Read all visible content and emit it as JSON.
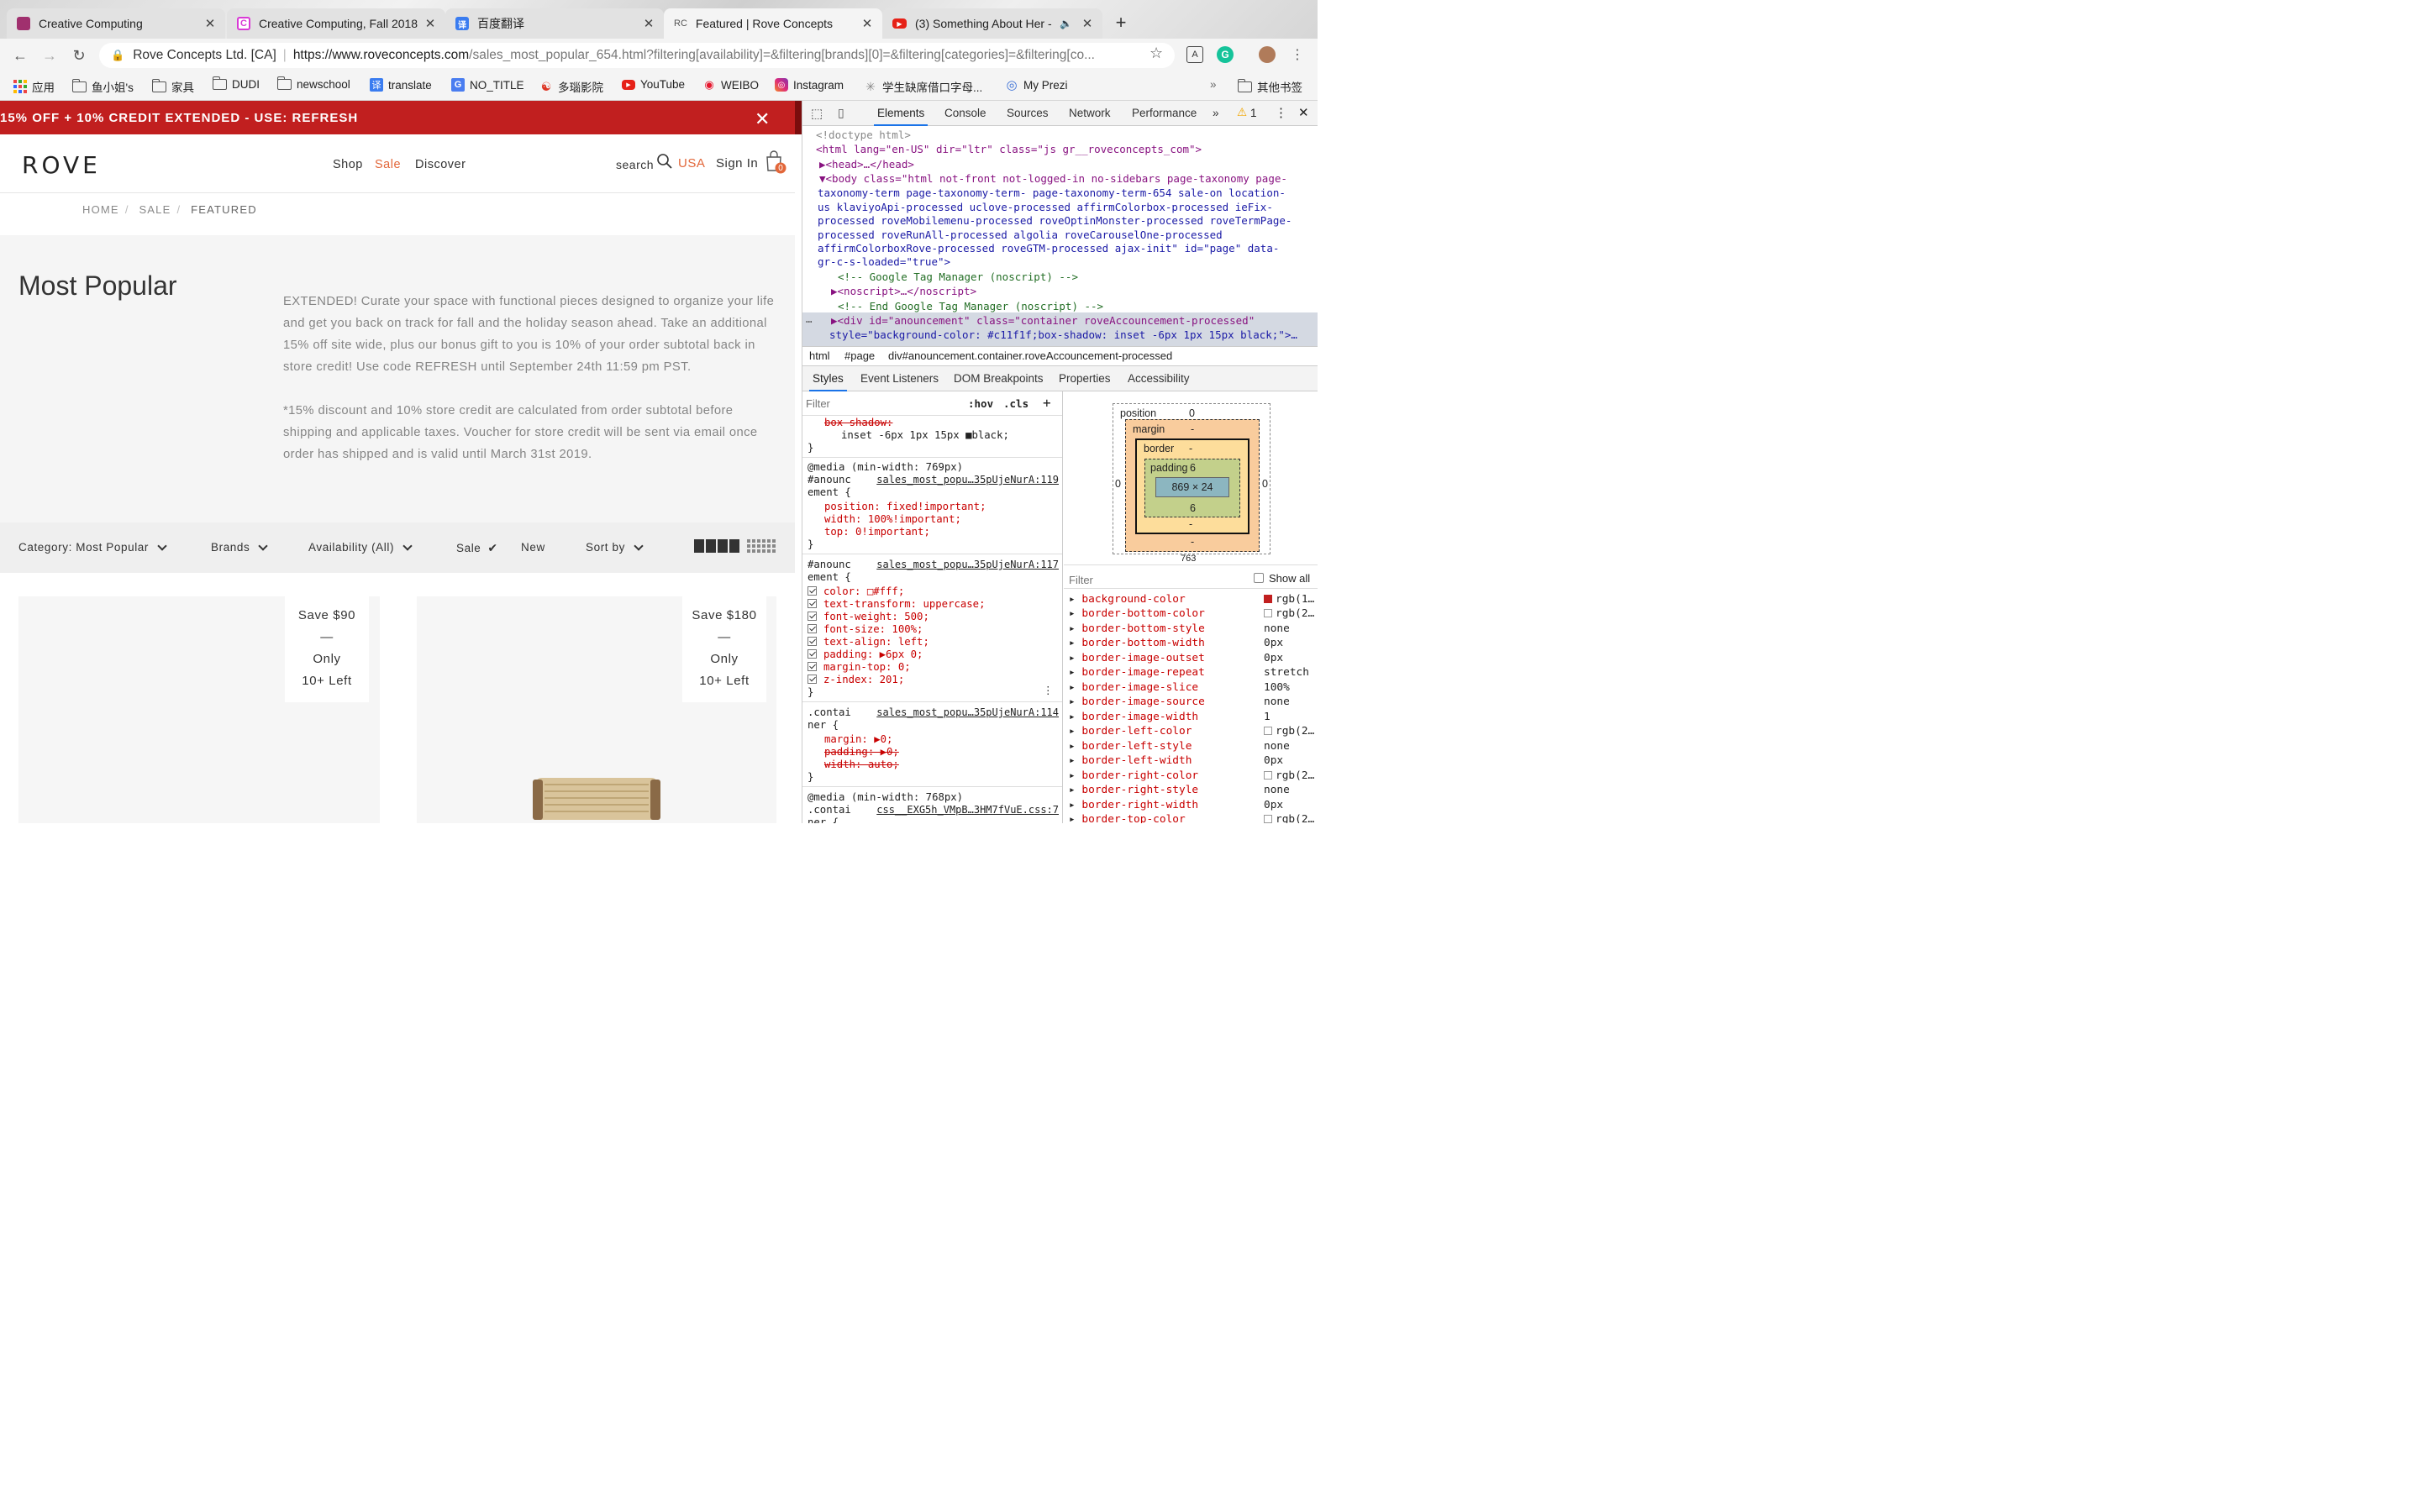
{
  "browser": {
    "tabs": [
      {
        "title": "Creative Computing",
        "fav_color": "#a0306e",
        "fav_glyph": ""
      },
      {
        "title": "Creative Computing, Fall 2018",
        "fav_color": "#d93ad6",
        "fav_glyph": "C"
      },
      {
        "title": "百度翻译",
        "fav_color": "#3a7cf0",
        "fav_glyph": "译"
      },
      {
        "title": "Featured | Rove Concepts",
        "fav_color": "#f4f4f4",
        "fav_glyph": "RC"
      },
      {
        "title": "(3) Something About Her -",
        "fav_color": "#e62117",
        "fav_glyph": "▶"
      }
    ],
    "url": {
      "org": "Rove Concepts Ltd. [CA]",
      "scheme_host": "https://www.roveconcepts.com",
      "path": "/sales_most_popular_654.html?filtering[availability]=&filtering[brands][0]=&filtering[categories]=&filtering[co..."
    },
    "bookmarks": [
      {
        "label": "应用",
        "type": "apps"
      },
      {
        "label": "鱼小姐's",
        "type": "folder"
      },
      {
        "label": "家具",
        "type": "folder"
      },
      {
        "label": "DUDI",
        "type": "folder"
      },
      {
        "label": "newschool",
        "type": "folder"
      },
      {
        "label": "translate",
        "type": "translate"
      },
      {
        "label": "NO_TITLE",
        "type": "google"
      },
      {
        "label": "多瑙影院",
        "type": "swirl"
      },
      {
        "label": "YouTube",
        "type": "youtube"
      },
      {
        "label": "WEIBO",
        "type": "weibo"
      },
      {
        "label": "Instagram",
        "type": "instagram"
      },
      {
        "label": "学生缺席借口字母...",
        "type": "leaf"
      },
      {
        "label": "My Prezi",
        "type": "prezi"
      }
    ],
    "bookmarks_more": "»",
    "other_bookmarks": "其他书签"
  },
  "site": {
    "announcement": "15% OFF + 10% CREDIT EXTENDED - USE: REFRESH",
    "logo": "ROVE",
    "nav": [
      "Shop",
      "Sale",
      "Discover"
    ],
    "search_label": "search",
    "region": "USA",
    "sign_in": "Sign In",
    "cart_count": "0",
    "breadcrumb": [
      "HOME",
      "SALE",
      "FEATURED"
    ],
    "page_title": "Most Popular",
    "description": [
      "EXTENDED! Curate your space with functional pieces designed to organize your life and get you back on track for fall and the holiday season ahead. Take an additional 15% off site wide, plus our bonus gift to you is 10% of your order subtotal back in store credit! Use code REFRESH until September 24th 11:59 pm PST.",
      "*15% discount and 10% store credit are calculated from order subtotal before shipping and applicable taxes. Voucher for store credit will be sent via email once order has shipped and is valid until March 31st 2019."
    ],
    "filters": {
      "category": "Category: Most Popular",
      "brands": "Brands",
      "availability": "Availability (All)",
      "sale": "Sale",
      "new": "New",
      "sort": "Sort by"
    },
    "products": [
      {
        "save": "Save $90",
        "dash": "—",
        "only": "Only",
        "left": "10+ Left"
      },
      {
        "save": "Save $180",
        "dash": "—",
        "only": "Only",
        "left": "10+ Left"
      }
    ]
  },
  "devtools": {
    "tabs": [
      "Elements",
      "Console",
      "Sources",
      "Network",
      "Performance"
    ],
    "tabs_more": "»",
    "warning_count": "1",
    "dom_lines": [
      "<!doctype html>",
      "<html lang=\"en-US\" dir=\"ltr\" class=\"js gr__roveconcepts_com\">",
      "▶<head>…</head>",
      "▼<body class=\"html not-front not-logged-in no-sidebars page-taxonomy page-",
      "taxonomy-term page-taxonomy-term- page-taxonomy-term-654 sale-on location-",
      "us klaviyoApi-processed uclove-processed affirmColorbox-processed ieFix-",
      "processed roveMobilemenu-processed roveOptinMonster-processed roveTermPage-",
      "processed roveRunAll-processed algolia roveCarouselOne-processed",
      "affirmColorboxRove-processed roveGTM-processed ajax-init\" id=\"page\" data-",
      "gr-c-s-loaded=\"true\">",
      "<!-- Google Tag Manager (noscript) -->",
      "▶<noscript>…</noscript>",
      "<!-- End Google Tag Manager (noscript) -->",
      "▶<div id=\"anouncement\" class=\"container roveAccouncement-processed\"",
      "style=\"background-color: #c11f1f;box-shadow: inset -6px 1px 15px black;\">…"
    ],
    "crumbs": [
      "html",
      "#page",
      "div#anouncement.container.roveAccouncement-processed"
    ],
    "sub_tabs": [
      "Styles",
      "Event Listeners",
      "DOM Breakpoints",
      "Properties",
      "Accessibility"
    ],
    "filter_placeholder": "Filter",
    "hov": ":hov",
    "cls": ".cls",
    "styles_lines": [
      "box-shadow:",
      "inset -6px 1px 15px ■black;",
      "}",
      "@media (min-width: 769px)",
      "#anounc",
      "ement {",
      "position: fixed!important;",
      "width: 100%!important;",
      "top: 0!important;",
      "}",
      "#anounc",
      "ement {",
      "color: □#fff;",
      "text-transform: uppercase;",
      "font-weight: 500;",
      "font-size: 100%;",
      "text-align: left;",
      "padding: ▶6px 0;",
      "margin-top: 0;",
      "z-index: 201;",
      "}",
      ".contai",
      "ner {",
      "margin: ▶0;",
      "padding: ▶0;",
      "width: auto;",
      "}",
      "@media (min-width: 768px)",
      ".contai",
      "ner {"
    ],
    "style_sources": [
      "sales_most_popu…35pUjeNurA:119",
      "sales_most_popu…35pUjeNurA:117",
      "sales_most_popu…35pUjeNurA:114",
      "css__EXG5h_VMpB…3HM7fVuE.css:7"
    ],
    "boxmodel": {
      "position": "position",
      "position_val": "0",
      "margin": "margin",
      "border": "border",
      "padding": "padding",
      "content": "869 × 24",
      "padding_top": "6",
      "padding_bottom": "6",
      "dash": "-",
      "side_zero": "0",
      "bottom_val": "763"
    },
    "computed_filter": "Filter",
    "show_all": "Show all",
    "computed": [
      {
        "name": "background-color",
        "value": "rgb(1…",
        "swatch": "#c11f1f"
      },
      {
        "name": "border-bottom-color",
        "value": "rgb(2…",
        "swatch": "#ffffff"
      },
      {
        "name": "border-bottom-style",
        "value": "none",
        "swatch": ""
      },
      {
        "name": "border-bottom-width",
        "value": "0px",
        "swatch": ""
      },
      {
        "name": "border-image-outset",
        "value": "0px",
        "swatch": ""
      },
      {
        "name": "border-image-repeat",
        "value": "stretch",
        "swatch": ""
      },
      {
        "name": "border-image-slice",
        "value": "100%",
        "swatch": ""
      },
      {
        "name": "border-image-source",
        "value": "none",
        "swatch": ""
      },
      {
        "name": "border-image-width",
        "value": "1",
        "swatch": ""
      },
      {
        "name": "border-left-color",
        "value": "rgb(2…",
        "swatch": "#ffffff"
      },
      {
        "name": "border-left-style",
        "value": "none",
        "swatch": ""
      },
      {
        "name": "border-left-width",
        "value": "0px",
        "swatch": ""
      },
      {
        "name": "border-right-color",
        "value": "rgb(2…",
        "swatch": "#ffffff"
      },
      {
        "name": "border-right-style",
        "value": "none",
        "swatch": ""
      },
      {
        "name": "border-right-width",
        "value": "0px",
        "swatch": ""
      },
      {
        "name": "border-top-color",
        "value": "rgb(2…",
        "swatch": "#ffffff"
      }
    ]
  },
  "colors": {
    "announcement_bg": "#c11f1f",
    "sale_accent": "#e2673a",
    "devtools_accent": "#1a73e8"
  }
}
